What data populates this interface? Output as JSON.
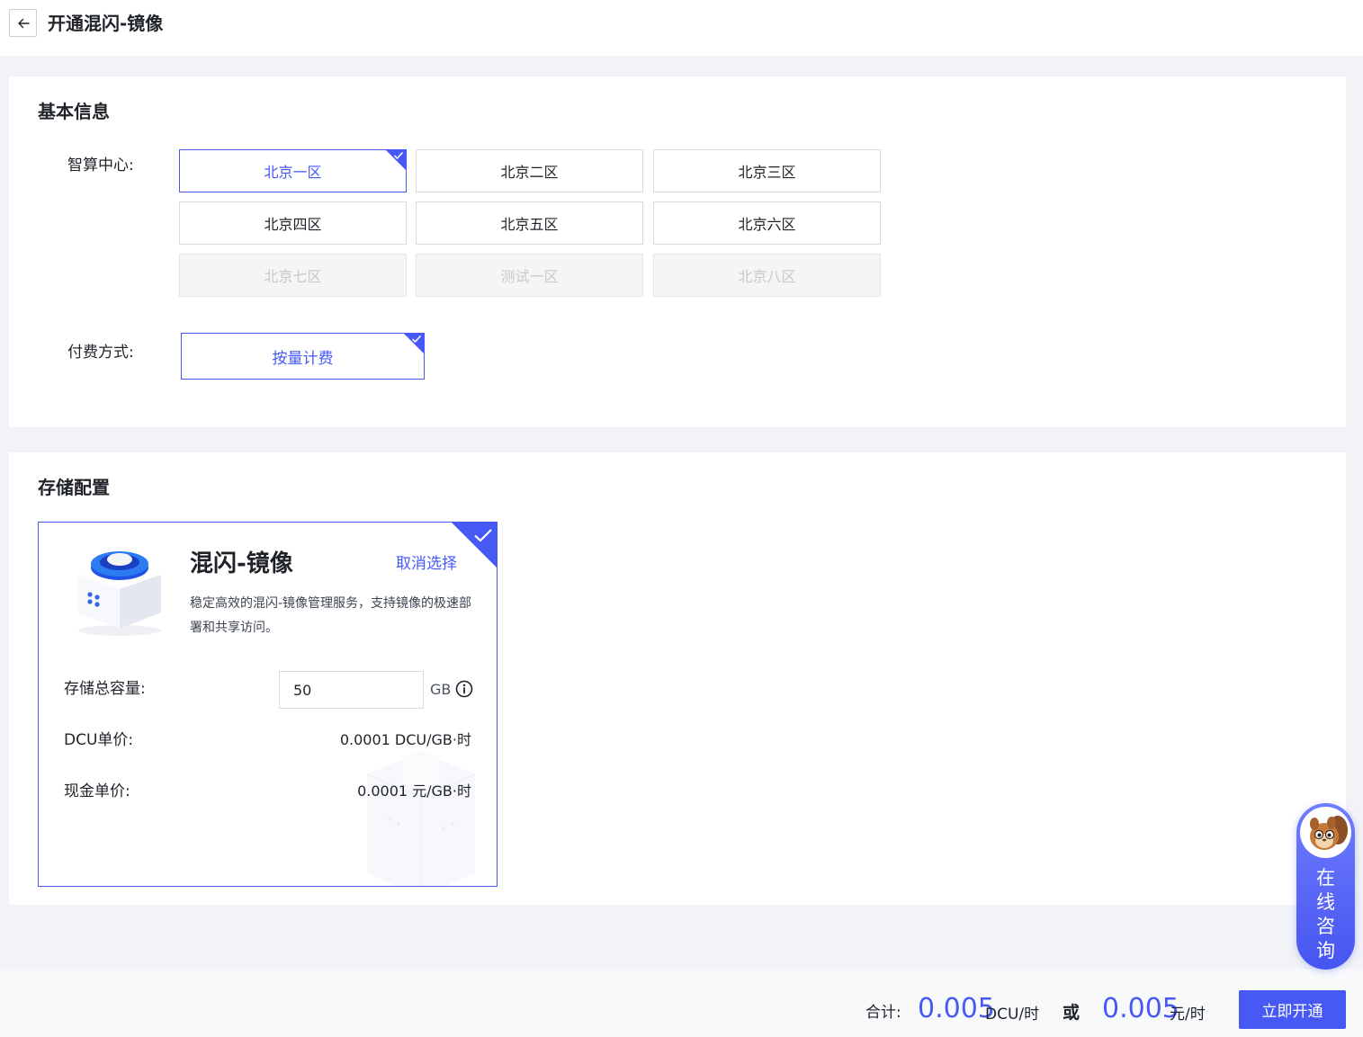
{
  "header": {
    "title": "开通混闪-镜像"
  },
  "basic": {
    "section_title": "基本信息",
    "center_label": "智算中心:",
    "centers": [
      {
        "label": "北京一区",
        "state": "selected"
      },
      {
        "label": "北京二区",
        "state": "normal"
      },
      {
        "label": "北京三区",
        "state": "normal"
      },
      {
        "label": "北京四区",
        "state": "normal"
      },
      {
        "label": "北京五区",
        "state": "normal"
      },
      {
        "label": "北京六区",
        "state": "normal"
      },
      {
        "label": "北京七区",
        "state": "disabled"
      },
      {
        "label": "测试一区",
        "state": "disabled"
      },
      {
        "label": "北京八区",
        "state": "disabled"
      }
    ],
    "pay_label": "付费方式:",
    "pay_option": "按量计费"
  },
  "storage": {
    "section_title": "存储配置",
    "product": {
      "name": "混闪-镜像",
      "cancel": "取消选择",
      "description": "稳定高效的混闪-镜像管理服务，支持镜像的极速部署和共享访问。",
      "capacity_label": "存储总容量:",
      "capacity_value": "50",
      "capacity_unit": "GB",
      "dcu_label": "DCU单价:",
      "dcu_value": "0.0001 DCU/GB·时",
      "cash_label": "现金单价:",
      "cash_value": "0.0001 元/GB·时"
    }
  },
  "footer": {
    "total_label": "合计:",
    "dcu_price": "0.005",
    "dcu_unit": "DCU/时",
    "or": "或",
    "cash_price": "0.005",
    "cash_unit": "元/时",
    "submit": "立即开通"
  },
  "consult": {
    "chars": [
      "在",
      "线",
      "咨",
      "询"
    ]
  },
  "colors": {
    "accent": "#4759f5",
    "disabled_bg": "#f5f5f5",
    "page_bg": "#f1f3f7"
  },
  "icons": {
    "back": "arrow-left-icon",
    "check": "check-icon",
    "info": "info-circle-icon"
  }
}
